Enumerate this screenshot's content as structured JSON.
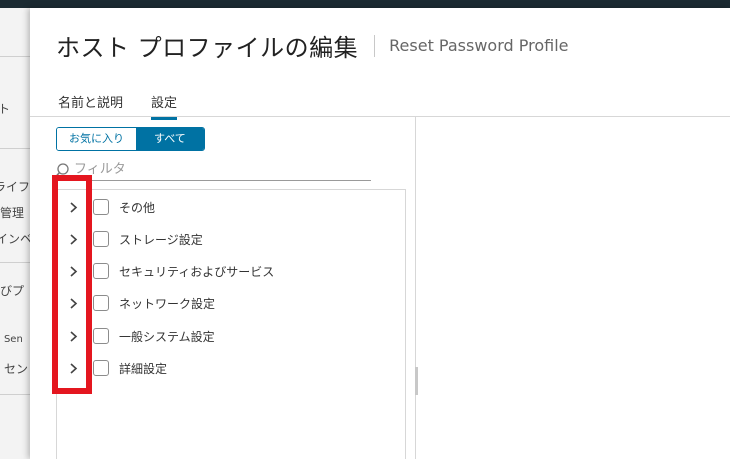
{
  "background": {
    "fragments": [
      "ト",
      "ライフ",
      "管理",
      "インベ",
      "びプ",
      "l Sen",
      "セン"
    ]
  },
  "dialog": {
    "title": "ホスト プロファイルの編集",
    "subtitle": "Reset Password Profile",
    "tabs": [
      {
        "label": "名前と説明"
      },
      {
        "label": "設定",
        "active": true
      }
    ],
    "toggle": {
      "favorites_label": "お気に入り",
      "all_label": "すべて",
      "selected": "すべて"
    },
    "filter": {
      "placeholder": "フィルタ",
      "value": ""
    },
    "tree": {
      "items": [
        {
          "label": "その他",
          "checked": false
        },
        {
          "label": "ストレージ設定",
          "checked": false
        },
        {
          "label": "セキュリティおよびサービス",
          "checked": false
        },
        {
          "label": "ネットワーク設定",
          "checked": false
        },
        {
          "label": "一般システム設定",
          "checked": false
        },
        {
          "label": "詳細設定",
          "checked": false
        }
      ]
    }
  },
  "colors": {
    "accent": "#0072a3",
    "highlight": "#e4161f",
    "header": "#1b2a32"
  }
}
